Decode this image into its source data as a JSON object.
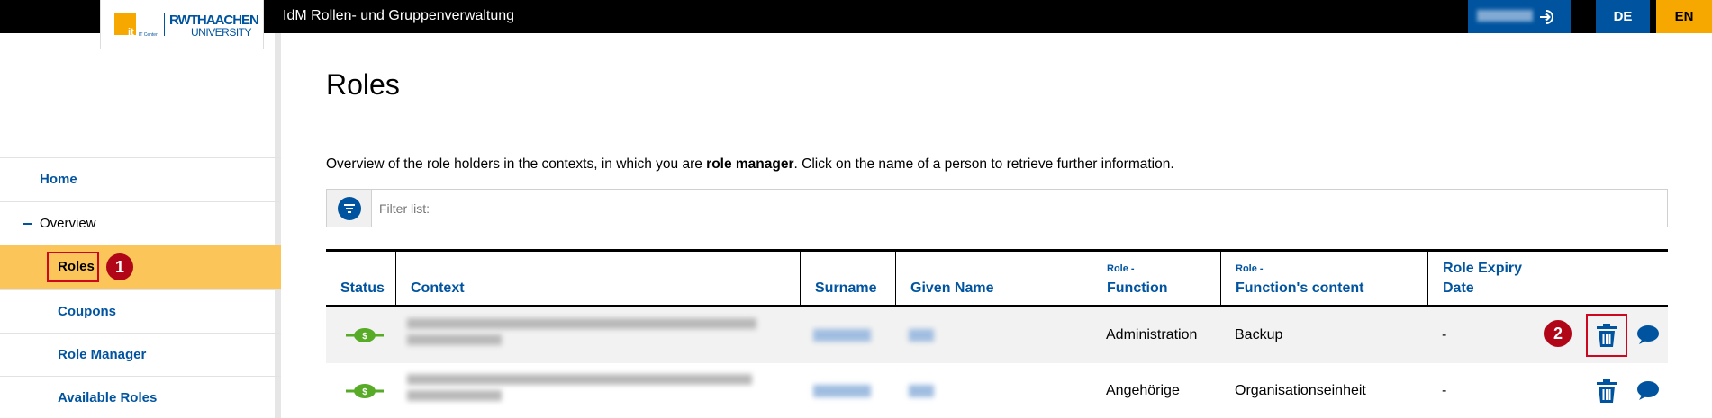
{
  "header": {
    "app_title": "IdM Rollen- und Gruppenverwaltung",
    "logo": {
      "it_mark": "it",
      "it_sub": "IT Center",
      "rwth": "RWTHAACHEN",
      "university": "UNIVERSITY"
    },
    "lang_de": "DE",
    "lang_en": "EN",
    "colors": {
      "bar": "#000000",
      "brand_blue": "#00549f",
      "brand_yellow": "#f6a800"
    }
  },
  "sidebar": {
    "items": [
      {
        "label": "Home"
      },
      {
        "label": "Overview"
      },
      {
        "label": "Roles"
      },
      {
        "label": "Coupons"
      },
      {
        "label": "Role Manager"
      },
      {
        "label": "Available Roles"
      }
    ],
    "annotation_1": "1"
  },
  "main": {
    "title": "Roles",
    "intro_before": "Overview of the role holders in the contexts, in which you are ",
    "intro_bold": "role manager",
    "intro_after": ". Click on the name of a person to retrieve further information.",
    "filter_placeholder": "Filter list:",
    "annotation_2": "2"
  },
  "table": {
    "columns": [
      {
        "main": "Status",
        "sub": ""
      },
      {
        "main": "Context",
        "sub": ""
      },
      {
        "main": "Surname",
        "sub": ""
      },
      {
        "main": "Given Name",
        "sub": ""
      },
      {
        "main": "Function",
        "sub": "Role -"
      },
      {
        "main": "Function's content",
        "sub": "Role -"
      },
      {
        "main": "Role Expiry",
        "main2": "Date",
        "sub": ""
      }
    ],
    "rows": [
      {
        "function": "Administration",
        "function_content": "Backup",
        "expiry": "-"
      },
      {
        "function": "Angehörige",
        "function_content": "Organisationseinheit",
        "expiry": "-"
      }
    ]
  }
}
